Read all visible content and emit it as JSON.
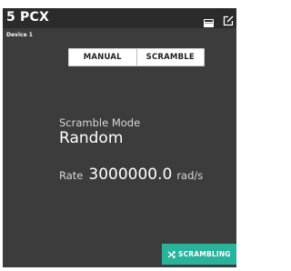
{
  "header": {
    "title": "5 PCX",
    "icons": [
      "screen-icon",
      "edit-icon"
    ]
  },
  "device": {
    "name": "Device 1"
  },
  "mode_toggle": {
    "manual_label": "MANUAL",
    "scramble_label": "SCRAMBLE",
    "selected": "SCRAMBLE"
  },
  "scramble": {
    "mode_label": "Scramble Mode",
    "mode_value": "Random",
    "rate_label": "Rate",
    "rate_value": "3000000.0",
    "rate_unit": "rad/s"
  },
  "status": {
    "label": "SCRAMBLING",
    "icon": "shuffle-icon",
    "color": "#28b39a"
  },
  "colors": {
    "panel_bg": "#3c3c3c",
    "titlebar_bg": "#2b2b2b",
    "accent": "#28b39a"
  }
}
